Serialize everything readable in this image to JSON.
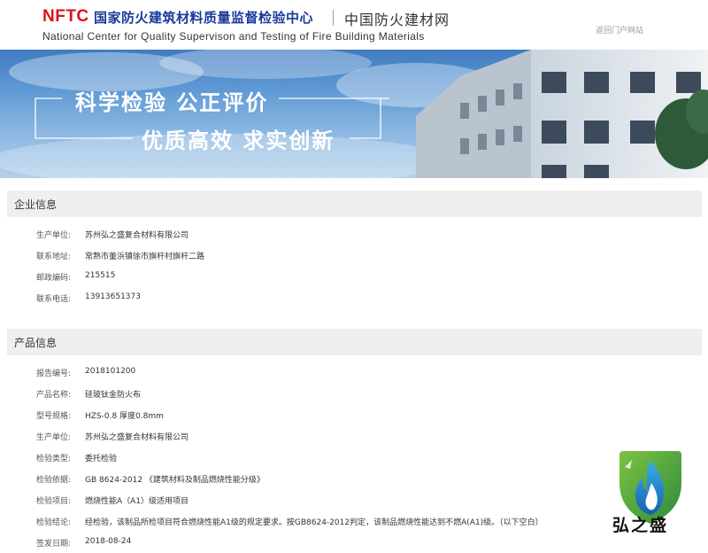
{
  "header": {
    "logo_abbr": "NFTC",
    "logo_cn": "国家防火建筑材料质量监督检验中心",
    "site_name": "中国防火建材网",
    "logo_en": "National Center for Quality Supervison and Testing of Fire Building Materials",
    "return_link": "返回门户网站"
  },
  "banner": {
    "slogan_line1": "科学检验  公正评价",
    "slogan_line2": "优质高效  求实创新"
  },
  "company": {
    "title": "企业信息",
    "rows": [
      {
        "label": "生产单位:",
        "value": "苏州弘之盛复合材料有限公司"
      },
      {
        "label": "联系地址:",
        "value": "常熟市董浜镇徐市旗杆村旗杆二路"
      },
      {
        "label": "邮政编码:",
        "value": "215515"
      },
      {
        "label": "联系电话:",
        "value": "13913651373"
      }
    ]
  },
  "product": {
    "title": "产品信息",
    "rows": [
      {
        "label": "报告编号:",
        "value": "2018101200"
      },
      {
        "label": "产品名称:",
        "value": "硅玻钛金防火布"
      },
      {
        "label": "型号规格:",
        "value": "HZS-0.8 厚度0.8mm"
      },
      {
        "label": "生产单位:",
        "value": "苏州弘之盛复合材料有限公司"
      },
      {
        "label": "检验类型:",
        "value": "委托检验"
      },
      {
        "label": "检验依据:",
        "value": "GB 8624-2012 《建筑材料及制品燃烧性能分级》"
      },
      {
        "label": "检验项目:",
        "value": "燃烧性能A（A1）级适用项目"
      },
      {
        "label": "检验结论:",
        "value": "经检验，该制品所检项目符合燃烧性能A1级的规定要求。按GB8624-2012判定，该制品燃烧性能达到不燃A(A1)级。（以下空白）"
      },
      {
        "label": "签发日期:",
        "value": "2018-08-24"
      }
    ]
  },
  "watermark": {
    "brand_text": "弘之盛"
  },
  "colors": {
    "nftc_red": "#d9151b",
    "title_blue": "#1a3a9c",
    "section_bg": "#efefef"
  }
}
